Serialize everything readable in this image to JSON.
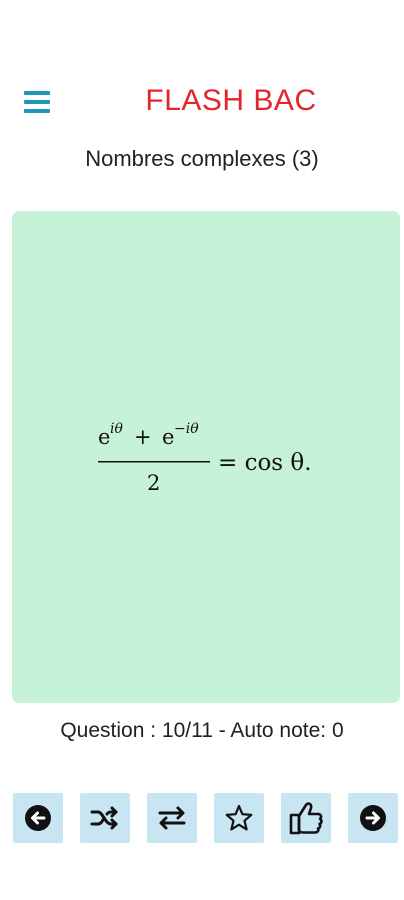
{
  "app": {
    "title": "FLASH BAC"
  },
  "deck": {
    "title": "Nombres complexes (3)"
  },
  "card": {
    "background": "#c6f2d7",
    "formula": {
      "num_e1": "e",
      "num_sup1": "iθ",
      "num_plus": "+",
      "num_e2": "e",
      "num_sup2": "−iθ",
      "den": "2",
      "rhs": "= cos θ."
    }
  },
  "status": {
    "text": "Question : 10/11 - Auto note: 0"
  },
  "toolbar": {
    "items": [
      {
        "icon": "arrow-left-circle-icon"
      },
      {
        "icon": "shuffle-icon"
      },
      {
        "icon": "swap-icon"
      },
      {
        "icon": "star-outline-icon"
      },
      {
        "icon": "thumbs-up-icon"
      },
      {
        "icon": "arrow-right-circle-icon"
      }
    ]
  },
  "colors": {
    "accent": "#e3262a",
    "menu": "#1f98b5",
    "toolbar_button": "#c8e6f2"
  }
}
